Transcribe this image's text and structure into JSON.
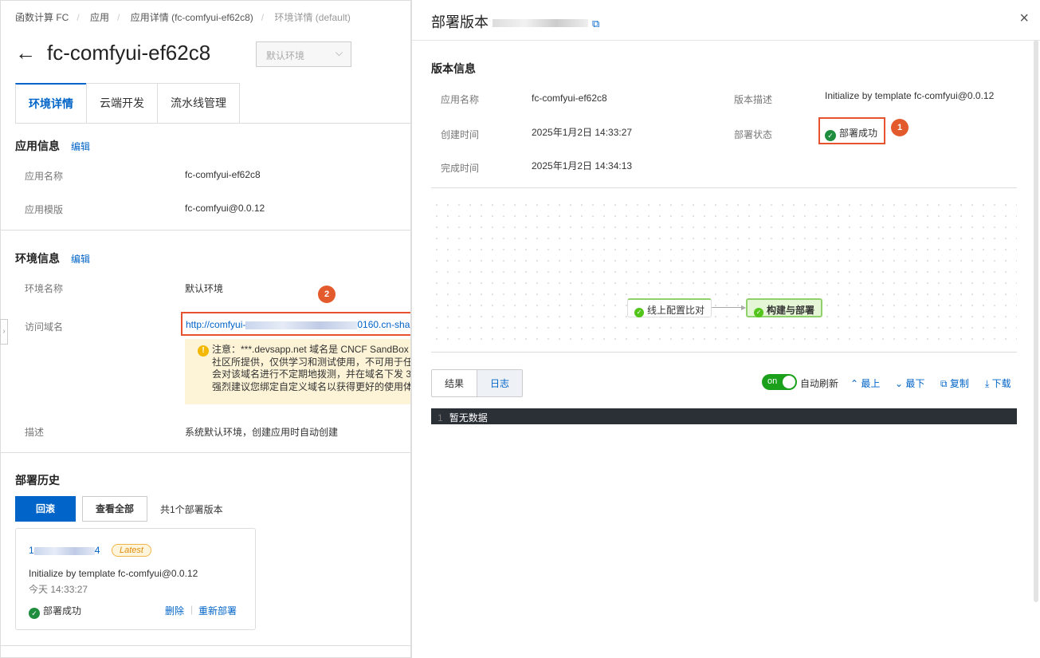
{
  "breadcrumb": [
    "函数计算 FC",
    "应用",
    "应用详情 (fc-comfyui-ef62c8)",
    "环境详情 (default)"
  ],
  "page": {
    "title": "fc-comfyui-ef62c8",
    "env_select": "默认环境"
  },
  "tabs": [
    "环境详情",
    "云端开发",
    "流水线管理"
  ],
  "app_info": {
    "title": "应用信息",
    "edit": "编辑",
    "name_label": "应用名称",
    "name": "fc-comfyui-ef62c8",
    "template_label": "应用模版",
    "template": "fc-comfyui@0.0.12"
  },
  "env_info": {
    "title": "环境信息",
    "edit": "编辑",
    "name_label": "环境名称",
    "name": "默认环境",
    "domain_label": "访问域名",
    "domain_prefix": "http://comfyui-",
    "domain_suffix": "0160.cn-sha",
    "notice_lines": [
      "注意：***.devsapp.net 域名是 CNCF SandBox 项",
      "社区所提供，仅供学习和测试使用，不可用于任",
      "会对该域名进行不定期地拨测，并在域名下发 3",
      "强烈建议您绑定自定义域名以获得更好的使用体"
    ],
    "desc_label": "描述",
    "desc": "系统默认环境，创建应用时自动创建"
  },
  "history": {
    "title": "部署历史",
    "rollback": "回滚",
    "view_all": "查看全部",
    "count": "共1个部署版本",
    "card": {
      "version_prefix": "1",
      "version_suffix": "4",
      "tag": "Latest",
      "desc": "Initialize by template fc-comfyui@0.0.12",
      "time": "今天 14:33:27",
      "status": "部署成功",
      "delete": "删除",
      "redeploy": "重新部署"
    }
  },
  "markers": [
    "1",
    "2"
  ],
  "drawer": {
    "title": "部署版本",
    "section": "版本信息",
    "app_name_label": "应用名称",
    "app_name": "fc-comfyui-ef62c8",
    "desc_label": "版本描述",
    "desc": "Initialize by template fc-comfyui@0.0.12",
    "created_label": "创建时间",
    "created": "2025年1月2日 14:33:27",
    "status_label": "部署状态",
    "status": "部署成功",
    "finished_label": "完成时间",
    "finished": "2025年1月2日 14:34:13",
    "pipeline": [
      "线上配置比对",
      "构建与部署"
    ],
    "log_tabs": [
      "结果",
      "日志"
    ],
    "toggle": "on",
    "auto_refresh": "自动刷新",
    "top": "最上",
    "bottom": "最下",
    "copy": "复制",
    "download": "下载",
    "log_line_no": "1",
    "log_text": "暂无数据"
  }
}
